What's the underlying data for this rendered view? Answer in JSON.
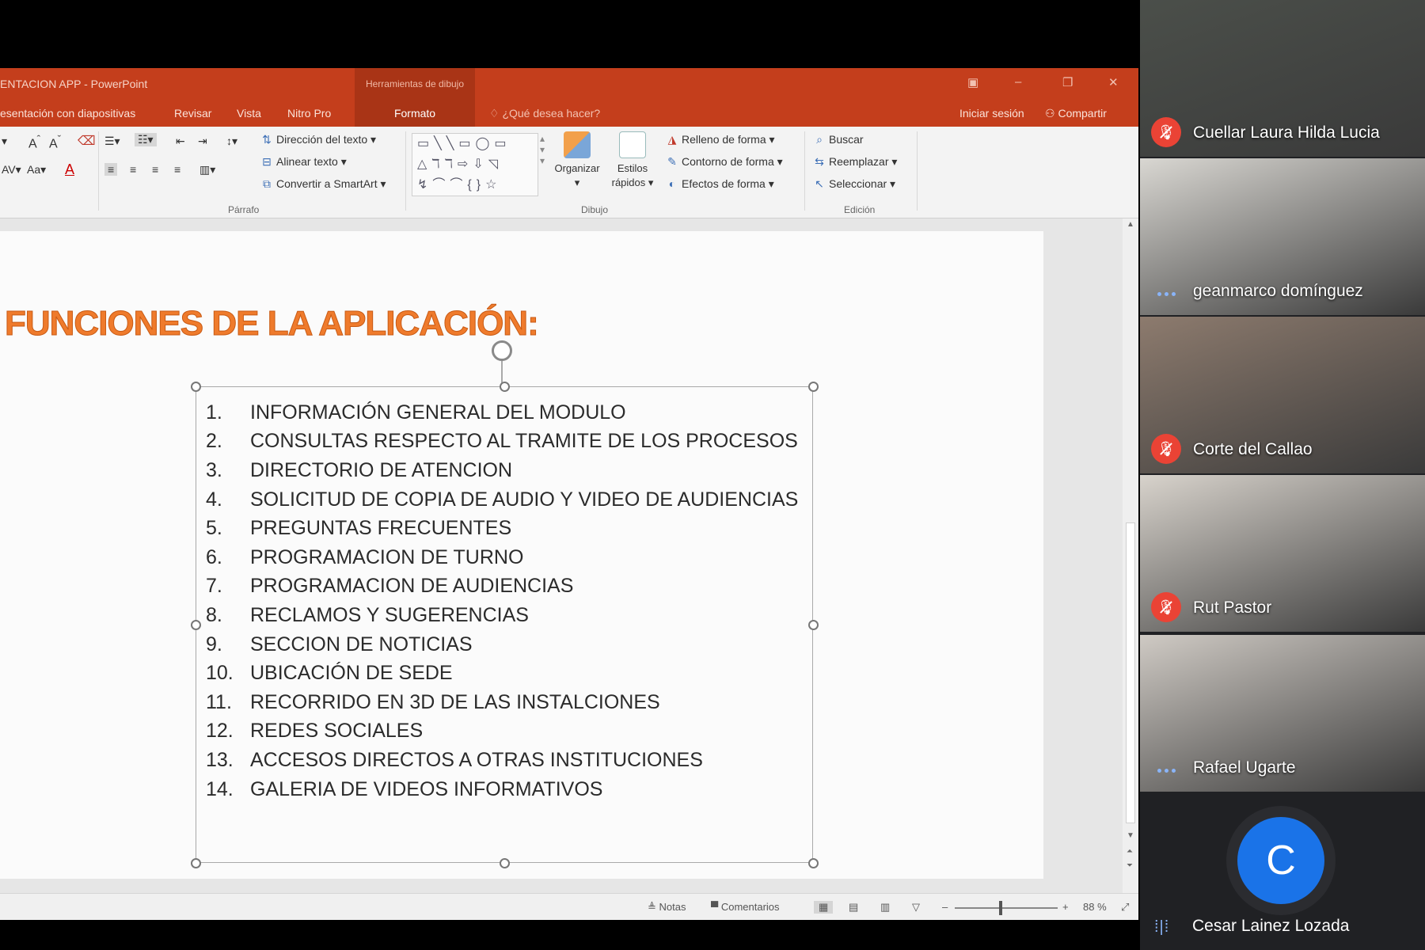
{
  "ppt": {
    "window_title": "ENTACION APP - PowerPoint",
    "context_tab_group": "Herramientas de dibujo",
    "tabs": [
      "esentación con diapositivas",
      "Revisar",
      "Vista",
      "Nitro Pro"
    ],
    "active_context_tab": "Formato",
    "tell_me": "¿Qué desea hacer?",
    "sign_in": "Iniciar sesión",
    "share": "Compartir",
    "ribbon": {
      "paragraph": {
        "text_direction": "Dirección del texto",
        "align_text": "Alinear texto",
        "convert_smartart": "Convertir a SmartArt",
        "label": "Párrafo"
      },
      "drawing": {
        "arrange": "Organizar",
        "quick_styles_line1": "Estilos",
        "quick_styles_line2": "rápidos",
        "shape_fill": "Relleno de forma",
        "shape_outline": "Contorno de forma",
        "shape_effects": "Efectos de forma",
        "label": "Dibujo"
      },
      "editing": {
        "find": "Buscar",
        "replace": "Reemplazar",
        "select": "Seleccionar",
        "label": "Edición"
      }
    },
    "slide": {
      "title": "FUNCIONES DE LA APLICACIÓN:",
      "items": [
        {
          "num": "1.",
          "text": "INFORMACIÓN GENERAL DEL MODULO"
        },
        {
          "num": "2.",
          "text": "CONSULTAS RESPECTO AL TRAMITE DE LOS PROCESOS"
        },
        {
          "num": "3.",
          "text": "DIRECTORIO DE ATENCION"
        },
        {
          "num": "4.",
          "text": "SOLICITUD DE COPIA DE AUDIO Y VIDEO DE AUDIENCIAS"
        },
        {
          "num": "5.",
          "text": "PREGUNTAS FRECUENTES"
        },
        {
          "num": "6.",
          "text": "PROGRAMACION DE TURNO"
        },
        {
          "num": "7.",
          "text": "PROGRAMACION DE AUDIENCIAS"
        },
        {
          "num": "8.",
          "text": "RECLAMOS Y SUGERENCIAS"
        },
        {
          "num": "9.",
          "text": "SECCION DE NOTICIAS"
        },
        {
          "num": "10.",
          "text": "UBICACIÓN DE SEDE"
        },
        {
          "num": "11.",
          "text": "RECORRIDO EN 3D DE LAS INSTALCIONES"
        },
        {
          "num": "12.",
          "text": "REDES SOCIALES"
        },
        {
          "num": "13.",
          "text": "ACCESOS  DIRECTOS A OTRAS INSTITUCIONES"
        },
        {
          "num": "14.",
          "text": "GALERIA DE VIDEOS INFORMATIVOS"
        }
      ]
    },
    "status": {
      "notes": "Notas",
      "comments": "Comentarios",
      "zoom": "88 %"
    }
  },
  "meet": {
    "participants": [
      {
        "name": "Cuellar Laura Hilda Lucia",
        "muted": true,
        "bg": "#4b4f4a"
      },
      {
        "name": "geanmarco domínguez",
        "muted": false,
        "bg": "#d9d7d2"
      },
      {
        "name": "Corte del Callao",
        "muted": true,
        "bg": "#8d7b6e"
      },
      {
        "name": "Rut Pastor",
        "muted": true,
        "bg": "#d8d3cc"
      },
      {
        "name": "Rafael Ugarte",
        "muted": false,
        "bg": "#cfcac4"
      },
      {
        "name": "Cesar Lainez Lozada",
        "muted": false,
        "avatar_letter": "C"
      }
    ]
  }
}
